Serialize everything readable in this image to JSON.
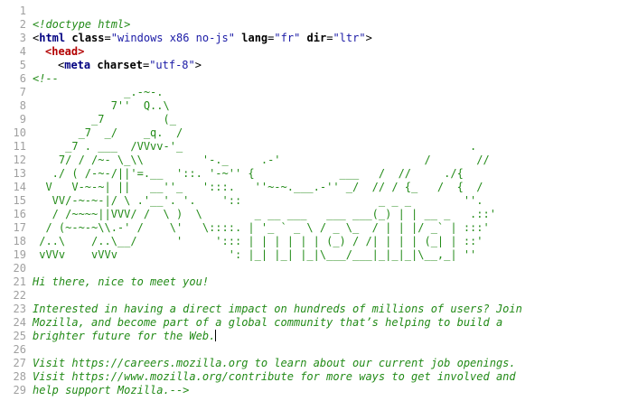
{
  "source": {
    "lines": [
      {
        "n": "1",
        "text": ""
      },
      {
        "n": "2",
        "text": "<!doctype html>"
      },
      {
        "n": "3",
        "tag_open": "<",
        "tag": "html",
        "attr1": "class",
        "val1": "\"windows x86 no-js\"",
        "attr2": "lang",
        "val2": "\"fr\"",
        "attr3": "dir",
        "val3": "\"ltr\"",
        "tag_close": ">"
      },
      {
        "n": "4",
        "text": "<head>"
      },
      {
        "n": "5",
        "tag_open": "<",
        "tag": "meta",
        "attr1": "charset",
        "val1": "\"utf-8\"",
        "tag_close": ">"
      },
      {
        "n": "6",
        "text": "<!--"
      },
      {
        "n": "7",
        "text": "              _.-~-."
      },
      {
        "n": "8",
        "text": "            7''  Q..\\"
      },
      {
        "n": "9",
        "text": "         _7         (_"
      },
      {
        "n": "10",
        "text": "       _7  _/    _q.  /"
      },
      {
        "n": "11",
        "text": "     _7 . ___  /VVvv-'_                                            ."
      },
      {
        "n": "12",
        "text": "    7/ / /~- \\_\\\\         '-._     .-'                      /       //"
      },
      {
        "n": "13",
        "text": "   ./ ( /-~-/||'=.__  '::. '-~'' {             ___   /  //     ./{"
      },
      {
        "n": "14",
        "text": "  V   V-~-~| ||   __''_   ':::.   ''~-~.___.-'' _/  // / {_   /  {  /"
      },
      {
        "n": "15",
        "text": "   VV/-~-~-|/ \\ .'__'. '.    '::                     _ _ _        ''."
      },
      {
        "n": "16",
        "text": "   / /~~~~||VVV/ /  \\ )  \\        _ __ ___   ___ ___(_) | | __ _   .::'"
      },
      {
        "n": "17",
        "text": "  / (~-~-~\\\\.-' /    \\'   \\::::. | '_ ` _ \\ / _ \\_  / | | |/ _` | :::'"
      },
      {
        "n": "18",
        "text": " /..\\    /..\\__/      '     '::: | | | | | | (_) / /| | | | (_| | ::'"
      },
      {
        "n": "19",
        "text": " vVVv    vVVv                 ': |_| |_| |_|\\___/___|_|_|_|\\__,_| ''"
      },
      {
        "n": "20",
        "text": ""
      },
      {
        "n": "21",
        "text": "Hi there, nice to meet you!"
      },
      {
        "n": "22",
        "text": ""
      },
      {
        "n": "23",
        "text": "Interested in having a direct impact on hundreds of millions of users? Join"
      },
      {
        "n": "24",
        "text": "Mozilla, and become part of a global community that’s helping to build a"
      },
      {
        "n": "25",
        "text": "brighter future for the Web."
      },
      {
        "n": "26",
        "text": ""
      },
      {
        "n": "27",
        "text": "Visit https://careers.mozilla.org to learn about our current job openings."
      },
      {
        "n": "28",
        "text": "Visit https://www.mozilla.org/contribute for more ways to get involved and"
      },
      {
        "n": "29",
        "text": "help support Mozilla.-->"
      }
    ]
  },
  "colors": {
    "comment": "#238b18",
    "tag": "#000080",
    "head_tag": "#b30000",
    "attr_value": "#1a1aa6",
    "line_number": "#a0a0a0"
  }
}
